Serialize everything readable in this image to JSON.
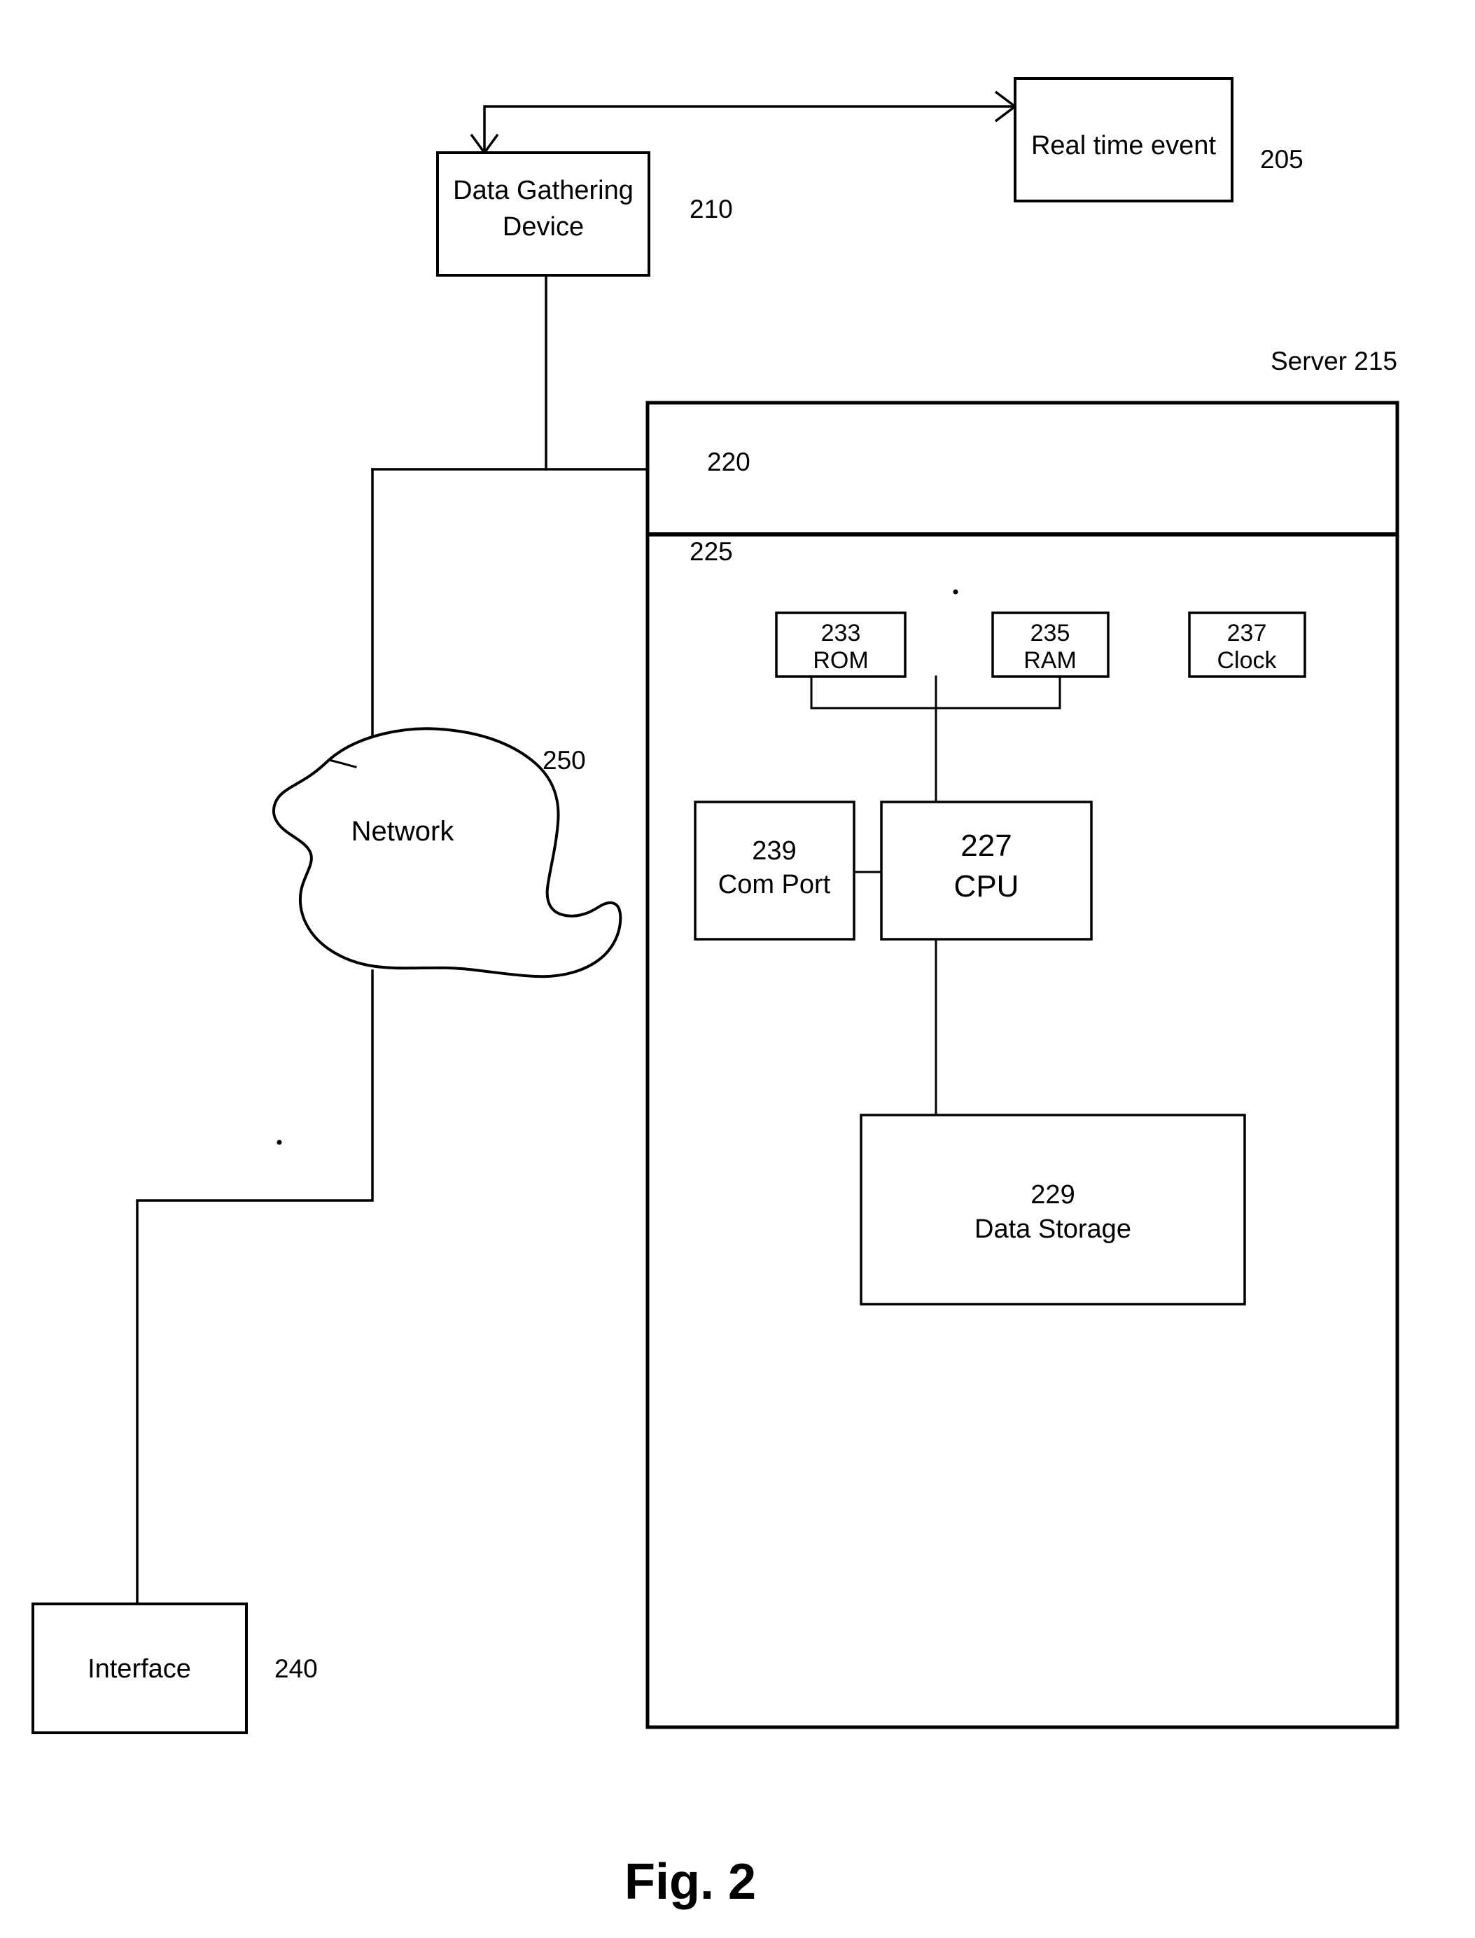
{
  "figure": {
    "caption": "Fig. 2"
  },
  "nodes": {
    "real_time_event": {
      "label": "Real time event",
      "ref": "205"
    },
    "data_gathering_device": {
      "label_line1": "Data Gathering",
      "label_line2": "Device",
      "ref": "210"
    },
    "server": {
      "label": "Server 215",
      "upper_section_ref": "220",
      "lower_section_ref": "225"
    },
    "rom": {
      "ref": "233",
      "label": "ROM"
    },
    "ram": {
      "ref": "235",
      "label": "RAM"
    },
    "clock": {
      "ref": "237",
      "label": "Clock"
    },
    "com_port": {
      "ref": "239",
      "label": "Com Port"
    },
    "cpu": {
      "ref": "227",
      "label": "CPU"
    },
    "data_storage": {
      "ref": "229",
      "label": "Data Storage"
    },
    "network": {
      "label": "Network",
      "ref": "250"
    },
    "interface": {
      "label": "Interface",
      "ref": "240"
    }
  },
  "colors": {
    "stroke": "#000000",
    "background": "#ffffff"
  }
}
